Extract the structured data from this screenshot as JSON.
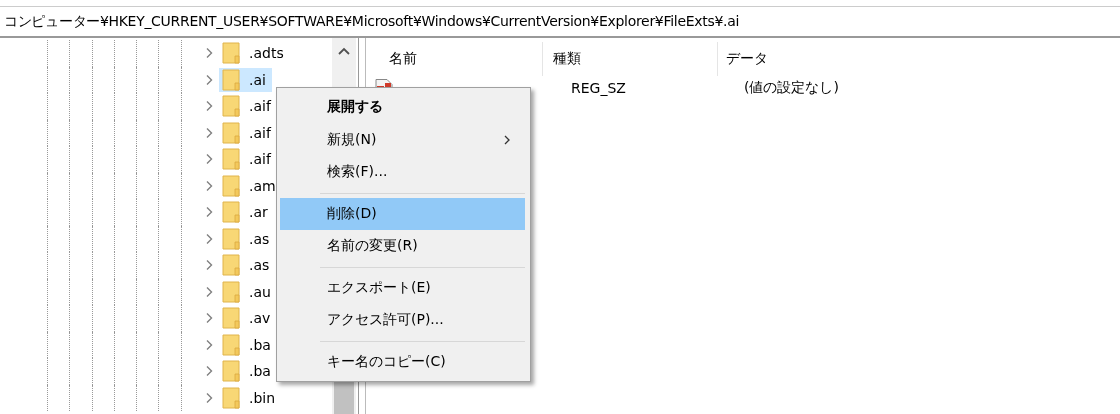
{
  "address_bar": {
    "path": "コンピューター¥HKEY_CURRENT_USER¥SOFTWARE¥Microsoft¥Windows¥CurrentVersion¥Explorer¥FileExts¥.ai"
  },
  "tree": {
    "items": [
      {
        "label": ".adts",
        "selected": false
      },
      {
        "label": ".ai",
        "selected": true
      },
      {
        "label": ".aif",
        "selected": false
      },
      {
        "label": ".aif",
        "selected": false
      },
      {
        "label": ".aif",
        "selected": false
      },
      {
        "label": ".am",
        "selected": false
      },
      {
        "label": ".ar",
        "selected": false
      },
      {
        "label": ".as",
        "selected": false
      },
      {
        "label": ".as",
        "selected": false
      },
      {
        "label": ".au",
        "selected": false
      },
      {
        "label": ".av",
        "selected": false
      },
      {
        "label": ".ba",
        "selected": false
      },
      {
        "label": ".ba",
        "selected": false
      },
      {
        "label": ".bin",
        "selected": false
      }
    ]
  },
  "list": {
    "columns": [
      "名前",
      "種類",
      "データ"
    ],
    "rows": [
      {
        "type": "REG_SZ",
        "data": "(値の設定なし)"
      }
    ]
  },
  "context_menu": {
    "items": [
      {
        "kind": "item",
        "label": "展開する",
        "default": true,
        "submenu": false,
        "selected": false
      },
      {
        "kind": "item",
        "label": "新規(N)",
        "default": false,
        "submenu": true,
        "selected": false
      },
      {
        "kind": "item",
        "label": "検索(F)...",
        "default": false,
        "submenu": false,
        "selected": false
      },
      {
        "kind": "separator"
      },
      {
        "kind": "item",
        "label": "削除(D)",
        "default": false,
        "submenu": false,
        "selected": true
      },
      {
        "kind": "item",
        "label": "名前の変更(R)",
        "default": false,
        "submenu": false,
        "selected": false
      },
      {
        "kind": "separator"
      },
      {
        "kind": "item",
        "label": "エクスポート(E)",
        "default": false,
        "submenu": false,
        "selected": false
      },
      {
        "kind": "item",
        "label": "アクセス許可(P)...",
        "default": false,
        "submenu": false,
        "selected": false
      },
      {
        "kind": "separator"
      },
      {
        "kind": "item",
        "label": "キー名のコピー(C)",
        "default": false,
        "submenu": false,
        "selected": false
      }
    ]
  }
}
